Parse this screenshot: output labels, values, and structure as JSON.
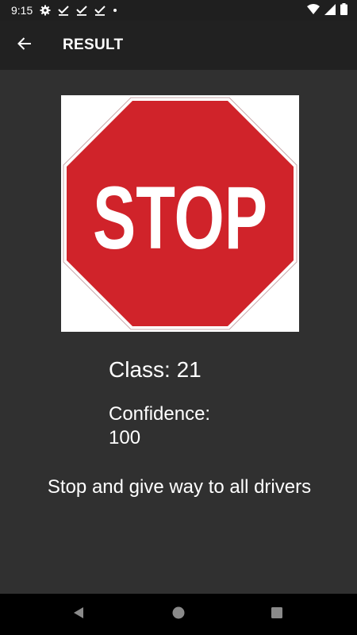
{
  "status_bar": {
    "time": "9:15",
    "icons": [
      "gear-icon",
      "check-download-icon",
      "check-download-icon",
      "check-download-icon",
      "dot-icon",
      "wifi-icon",
      "signal-icon",
      "battery-icon"
    ]
  },
  "app_bar": {
    "back_icon": "arrow-left-icon",
    "title": "RESULT"
  },
  "result": {
    "image_text": "STOP",
    "class_text": "Class: 21",
    "confidence_label": "Confidence:",
    "confidence_value": "100",
    "description": "Stop and give way to all drivers"
  },
  "nav_bar": {
    "icons": [
      "back-triangle-icon",
      "home-circle-icon",
      "recents-square-icon"
    ]
  },
  "colors": {
    "background": "#303030",
    "app_bar": "#212121",
    "status_bar": "#1f1f1f",
    "sign_red": "#d0232a",
    "text": "#ffffff"
  }
}
